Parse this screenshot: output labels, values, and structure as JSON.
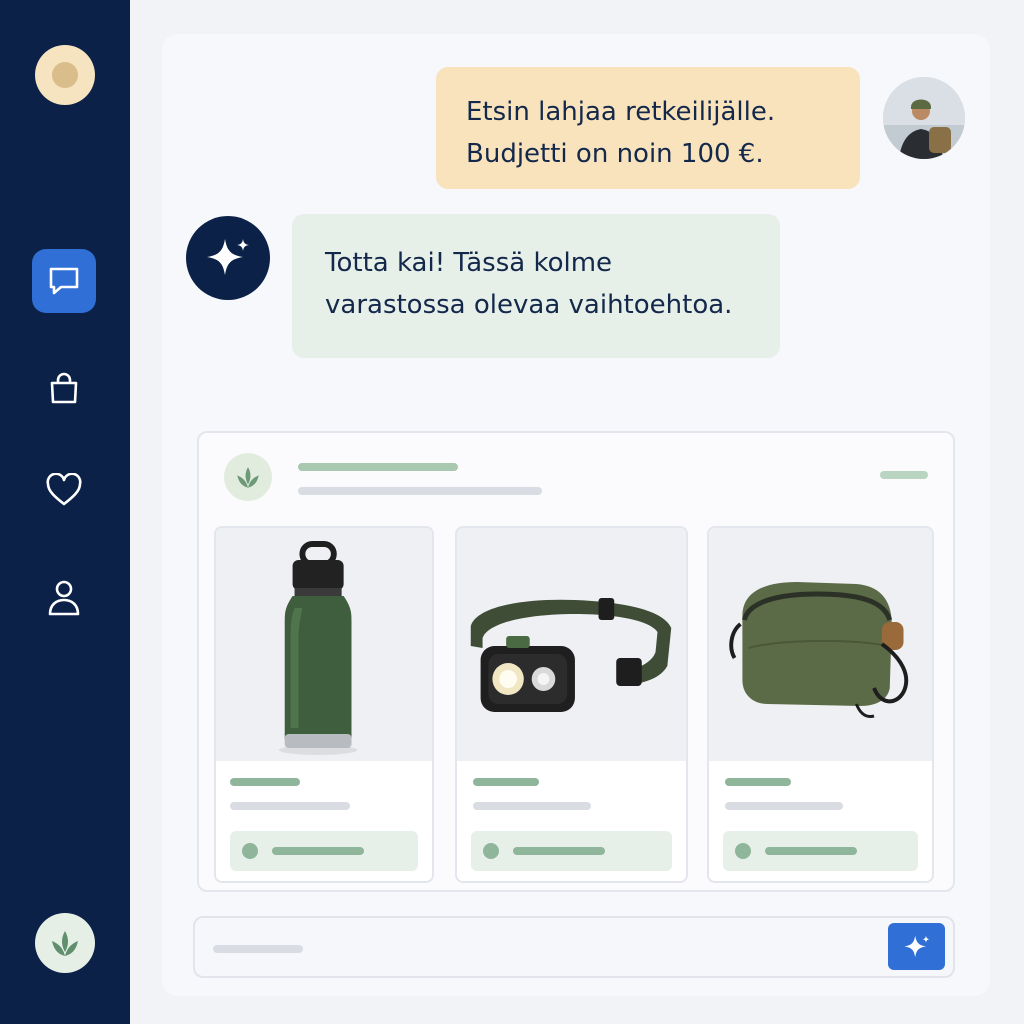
{
  "chat": {
    "user_message": {
      "line1": "Etsin lahjaa retkeilijälle.",
      "line2": "Budjetti on noin 100 €."
    },
    "bot_message": {
      "line1": "Totta kai! Tässä kolme",
      "line2": "varastossa olevaa vaihtoehtoa."
    }
  },
  "sidebar": {
    "items": [
      {
        "icon": "chat-bubble-icon",
        "active": true
      },
      {
        "icon": "shopping-bag-icon",
        "active": false
      },
      {
        "icon": "heart-icon",
        "active": false
      },
      {
        "icon": "user-icon",
        "active": false
      }
    ],
    "bottom_icon": "leaf-icon"
  },
  "recommendations": {
    "logo_icon": "leaf-icon",
    "products": [
      {
        "image": "water-bottle"
      },
      {
        "image": "headlamp"
      },
      {
        "image": "hip-pack"
      }
    ]
  },
  "composer": {
    "send_icon": "sparkle-icon"
  },
  "colors": {
    "sidebar_bg": "#0b2147",
    "accent_blue": "#2f6fd6",
    "user_bubble": "#f8e3bd",
    "bot_bubble": "#e6efe8",
    "sage": "#8fb59a"
  }
}
